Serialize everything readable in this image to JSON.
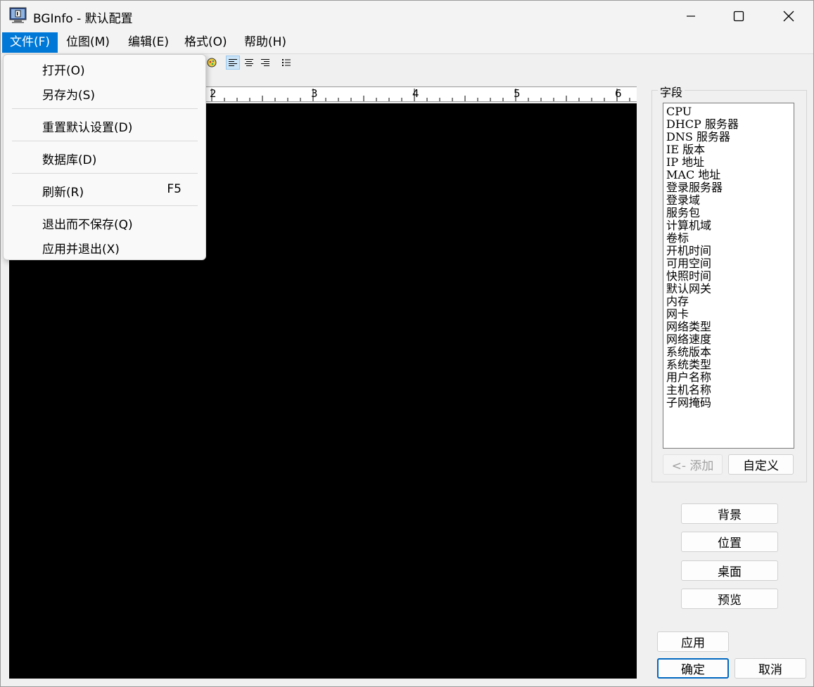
{
  "window": {
    "title": "BGInfo - 默认配置"
  },
  "menubar": {
    "items": [
      "文件(F)",
      "位图(M)",
      "编辑(E)",
      "格式(O)",
      "帮助(H)"
    ]
  },
  "file_menu": {
    "items": [
      {
        "label": "打开(O)"
      },
      {
        "label": "另存为(S)"
      },
      {
        "label": "重置默认设置(D)"
      },
      {
        "label": "数据库(D)"
      },
      {
        "label": "刷新(R)",
        "shortcut": "F5"
      },
      {
        "label": "退出而不保存(Q)"
      },
      {
        "label": "应用并退出(X)"
      }
    ]
  },
  "ruler": {
    "numbers": [
      "2",
      "3",
      "4",
      "5",
      "6"
    ]
  },
  "fields": {
    "group_label": "字段",
    "items": [
      "CPU",
      "DHCP 服务器",
      "DNS 服务器",
      "IE 版本",
      "IP 地址",
      "MAC 地址",
      "登录服务器",
      "登录域",
      "服务包",
      "计算机域",
      "卷标",
      "开机时间",
      "可用空间",
      "快照时间",
      "默认网关",
      "内存",
      "网卡",
      "网络类型",
      "网络速度",
      "系统版本",
      "系统类型",
      "用户名称",
      "主机名称",
      "子网掩码"
    ],
    "add_button": "<- 添加",
    "custom_button": "自定义"
  },
  "side_buttons": {
    "background": "背景",
    "position": "位置",
    "desktop": "桌面",
    "preview": "预览"
  },
  "bottom_buttons": {
    "apply": "应用",
    "ok": "确定",
    "cancel": "取消"
  },
  "colors": {
    "accent": "#0078d7",
    "canvas": "#000000"
  }
}
